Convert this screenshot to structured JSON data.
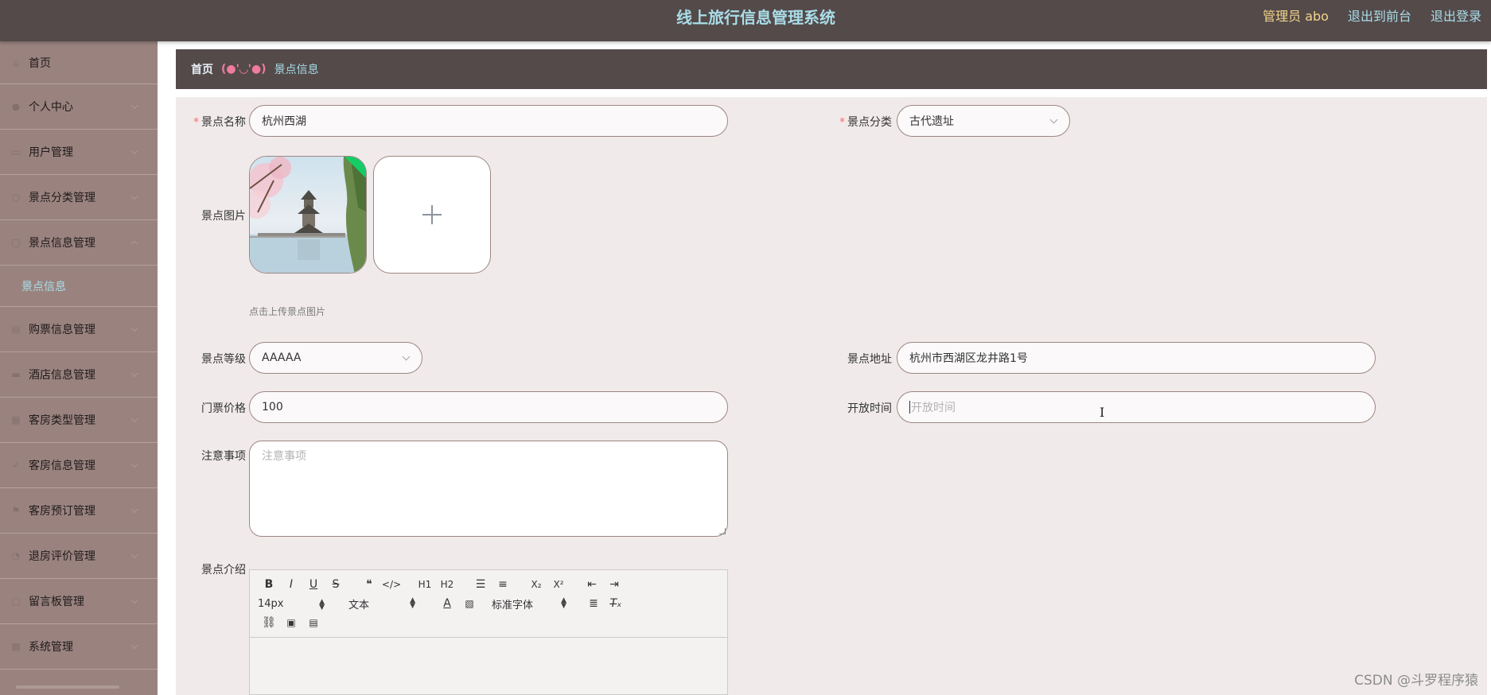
{
  "header": {
    "title": "线上旅行信息管理系统",
    "admin_label": "管理员 abo",
    "front_link": "退出到前台",
    "logout_link": "退出登录"
  },
  "sidebar": {
    "items": [
      {
        "label": "首页",
        "icon": "home-icon"
      },
      {
        "label": "个人中心",
        "icon": "user-icon"
      },
      {
        "label": "用户管理",
        "icon": "users-icon"
      },
      {
        "label": "景点分类管理",
        "icon": "category-icon"
      },
      {
        "label": "景点信息管理",
        "icon": "scenic-icon"
      },
      {
        "label": "购票信息管理",
        "icon": "ticket-icon"
      },
      {
        "label": "酒店信息管理",
        "icon": "hotel-icon"
      },
      {
        "label": "客房类型管理",
        "icon": "room-type-icon"
      },
      {
        "label": "客房信息管理",
        "icon": "room-icon"
      },
      {
        "label": "客房预订管理",
        "icon": "booking-icon"
      },
      {
        "label": "退房评价管理",
        "icon": "review-icon"
      },
      {
        "label": "留言板管理",
        "icon": "message-icon"
      },
      {
        "label": "系统管理",
        "icon": "settings-icon"
      }
    ],
    "sub_item": "景点信息"
  },
  "breadcrumb": {
    "home": "首页",
    "separator": "(●'◡'●)",
    "current": "景点信息"
  },
  "form": {
    "name": {
      "label": "景点名称",
      "value": "杭州西湖"
    },
    "category": {
      "label": "景点分类",
      "value": "古代遗址"
    },
    "image": {
      "label": "景点图片",
      "hint": "点击上传景点图片"
    },
    "level": {
      "label": "景点等级",
      "value": "AAAAA"
    },
    "address": {
      "label": "景点地址",
      "value": "杭州市西湖区龙井路1号"
    },
    "price": {
      "label": "门票价格",
      "value": "100"
    },
    "open_time": {
      "label": "开放时间",
      "placeholder": "开放时间"
    },
    "notes": {
      "label": "注意事项",
      "placeholder": "注意事项"
    },
    "intro": {
      "label": "景点介绍"
    }
  },
  "editor": {
    "font_size": "14px",
    "block_type": "文本",
    "font_family": "标准字体",
    "buttons_row1": [
      "B",
      "I",
      "U",
      "S",
      "❝",
      "</>",
      "H1",
      "H2",
      "ordered-list",
      "bullet-list",
      "X₂",
      "X²",
      "outdent",
      "indent"
    ]
  },
  "watermark": "CSDN @斗罗程序猿",
  "colors": {
    "header_bg": "#544a4a",
    "sidebar_bg": "#9a837f",
    "accent": "#a9dde8",
    "form_bg": "#f0ebea"
  }
}
